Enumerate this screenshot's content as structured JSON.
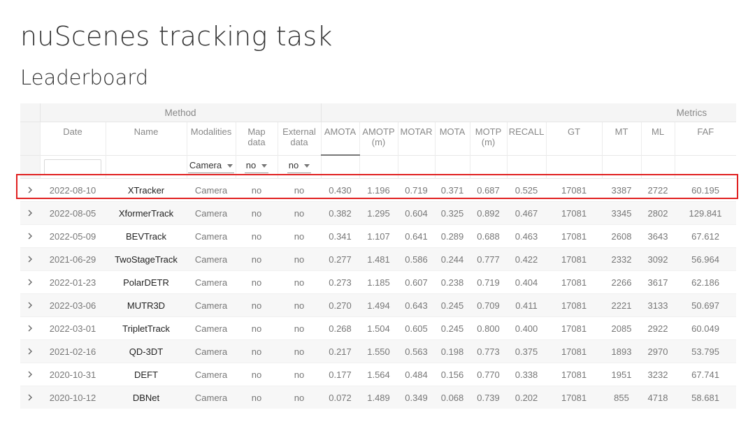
{
  "header": {
    "title": "nuScenes tracking task",
    "subtitle": "Leaderboard"
  },
  "table": {
    "groups": {
      "method": "Method",
      "metrics": "Metrics"
    },
    "columns": [
      {
        "key": "date",
        "label": "Date"
      },
      {
        "key": "name",
        "label": "Name"
      },
      {
        "key": "modalities",
        "label": "Modalities"
      },
      {
        "key": "map",
        "label": "Map\ndata"
      },
      {
        "key": "external",
        "label": "External\ndata"
      },
      {
        "key": "amota",
        "label": "AMOTA"
      },
      {
        "key": "amotp",
        "label": "AMOTP\n(m)"
      },
      {
        "key": "motar",
        "label": "MOTAR"
      },
      {
        "key": "mota",
        "label": "MOTA"
      },
      {
        "key": "motp",
        "label": "MOTP\n(m)"
      },
      {
        "key": "recall",
        "label": "RECALL"
      },
      {
        "key": "gt",
        "label": "GT"
      },
      {
        "key": "mt",
        "label": "MT"
      },
      {
        "key": "ml",
        "label": "ML"
      },
      {
        "key": "faf",
        "label": "FAF"
      }
    ],
    "sorted_column": "AMOTA",
    "filters": {
      "date_value": "",
      "modalities": "Camera",
      "map": "no",
      "external": "no"
    },
    "rows": [
      {
        "date": "2022-08-10",
        "name": "XTracker",
        "modalities": "Camera",
        "map": "no",
        "external": "no",
        "amota": "0.430",
        "amotp": "1.196",
        "motar": "0.719",
        "mota": "0.371",
        "motp": "0.687",
        "recall": "0.525",
        "gt": "17081",
        "mt": "3387",
        "ml": "2722",
        "faf": "60.195"
      },
      {
        "date": "2022-08-05",
        "name": "XformerTrack",
        "modalities": "Camera",
        "map": "no",
        "external": "no",
        "amota": "0.382",
        "amotp": "1.295",
        "motar": "0.604",
        "mota": "0.325",
        "motp": "0.892",
        "recall": "0.467",
        "gt": "17081",
        "mt": "3345",
        "ml": "2802",
        "faf": "129.841"
      },
      {
        "date": "2022-05-09",
        "name": "BEVTrack",
        "modalities": "Camera",
        "map": "no",
        "external": "no",
        "amota": "0.341",
        "amotp": "1.107",
        "motar": "0.641",
        "mota": "0.289",
        "motp": "0.688",
        "recall": "0.463",
        "gt": "17081",
        "mt": "2608",
        "ml": "3643",
        "faf": "67.612"
      },
      {
        "date": "2021-06-29",
        "name": "TwoStageTrack",
        "modalities": "Camera",
        "map": "no",
        "external": "no",
        "amota": "0.277",
        "amotp": "1.481",
        "motar": "0.586",
        "mota": "0.244",
        "motp": "0.777",
        "recall": "0.422",
        "gt": "17081",
        "mt": "2332",
        "ml": "3092",
        "faf": "56.964"
      },
      {
        "date": "2022-01-23",
        "name": "PolarDETR",
        "modalities": "Camera",
        "map": "no",
        "external": "no",
        "amota": "0.273",
        "amotp": "1.185",
        "motar": "0.607",
        "mota": "0.238",
        "motp": "0.719",
        "recall": "0.404",
        "gt": "17081",
        "mt": "2266",
        "ml": "3617",
        "faf": "62.186"
      },
      {
        "date": "2022-03-06",
        "name": "MUTR3D",
        "modalities": "Camera",
        "map": "no",
        "external": "no",
        "amota": "0.270",
        "amotp": "1.494",
        "motar": "0.643",
        "mota": "0.245",
        "motp": "0.709",
        "recall": "0.411",
        "gt": "17081",
        "mt": "2221",
        "ml": "3133",
        "faf": "50.697"
      },
      {
        "date": "2022-03-01",
        "name": "TripletTrack",
        "modalities": "Camera",
        "map": "no",
        "external": "no",
        "amota": "0.268",
        "amotp": "1.504",
        "motar": "0.605",
        "mota": "0.245",
        "motp": "0.800",
        "recall": "0.400",
        "gt": "17081",
        "mt": "2085",
        "ml": "2922",
        "faf": "60.049"
      },
      {
        "date": "2021-02-16",
        "name": "QD-3DT",
        "modalities": "Camera",
        "map": "no",
        "external": "no",
        "amota": "0.217",
        "amotp": "1.550",
        "motar": "0.563",
        "mota": "0.198",
        "motp": "0.773",
        "recall": "0.375",
        "gt": "17081",
        "mt": "1893",
        "ml": "2970",
        "faf": "53.795"
      },
      {
        "date": "2020-10-31",
        "name": "DEFT",
        "modalities": "Camera",
        "map": "no",
        "external": "no",
        "amota": "0.177",
        "amotp": "1.564",
        "motar": "0.484",
        "mota": "0.156",
        "motp": "0.770",
        "recall": "0.338",
        "gt": "17081",
        "mt": "1951",
        "ml": "3232",
        "faf": "67.741"
      },
      {
        "date": "2020-10-12",
        "name": "DBNet",
        "modalities": "Camera",
        "map": "no",
        "external": "no",
        "amota": "0.072",
        "amotp": "1.489",
        "motar": "0.349",
        "mota": "0.068",
        "motp": "0.739",
        "recall": "0.202",
        "gt": "17081",
        "mt": "855",
        "ml": "4718",
        "faf": "58.681"
      }
    ]
  },
  "colors": {
    "highlight_border": "#e02020",
    "group_header_bg": "#f5f5f5",
    "stripe_bg": "#f7f7f7"
  },
  "icons": {
    "expand": "chevron-right-icon",
    "dropdown": "caret-down-icon"
  }
}
